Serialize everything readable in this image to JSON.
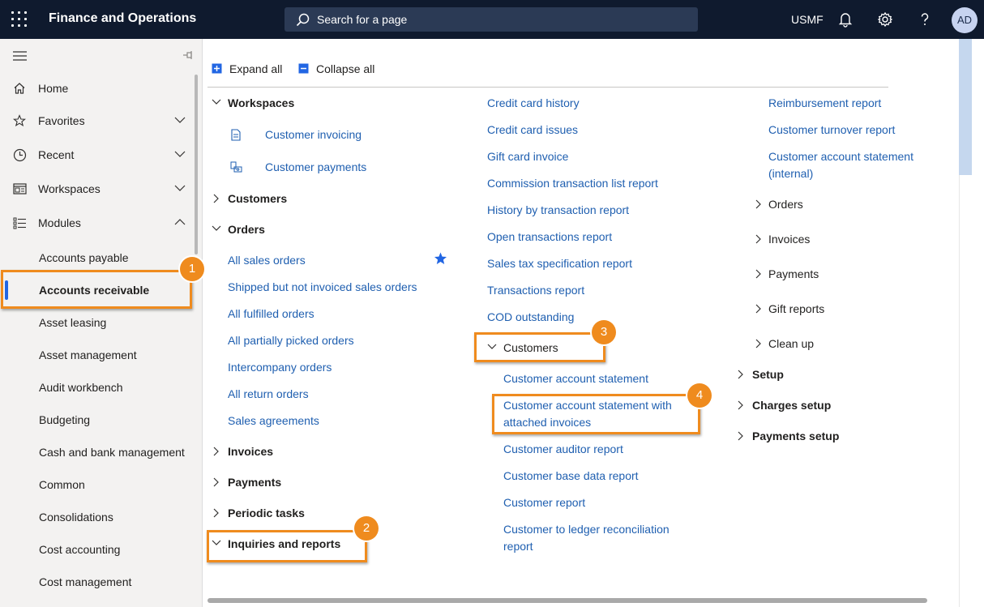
{
  "header": {
    "app_title": "Finance and Operations",
    "search_placeholder": "Search for a page",
    "company": "USMF",
    "avatar_initials": "AD"
  },
  "sidebar": {
    "nav": [
      {
        "label": "Home",
        "icon": "home-icon"
      },
      {
        "label": "Favorites",
        "icon": "star-icon"
      },
      {
        "label": "Recent",
        "icon": "clock-icon"
      },
      {
        "label": "Workspaces",
        "icon": "workspace-icon"
      },
      {
        "label": "Modules",
        "icon": "list-icon"
      }
    ],
    "modules": [
      "Accounts payable",
      "Accounts receivable",
      "Asset leasing",
      "Asset management",
      "Audit workbench",
      "Budgeting",
      "Cash and bank management",
      "Common",
      "Consolidations",
      "Cost accounting",
      "Cost management"
    ],
    "selected_module": "Accounts receivable"
  },
  "toolbar": {
    "expand_all": "Expand all",
    "collapse_all": "Collapse all"
  },
  "col1": {
    "workspaces": "Workspaces",
    "workspace_links": [
      "Customer invoicing",
      "Customer payments"
    ],
    "customers": "Customers",
    "orders": "Orders",
    "order_links": [
      "All sales orders",
      "Shipped but not invoiced sales orders",
      "All fulfilled orders",
      "All partially picked orders",
      "Intercompany orders",
      "All return orders",
      "Sales agreements"
    ],
    "invoices": "Invoices",
    "payments": "Payments",
    "periodic_tasks": "Periodic tasks",
    "inquiries_reports": "Inquiries and reports"
  },
  "col2": {
    "links": [
      "Credit card history",
      "Credit card issues",
      "Gift card invoice",
      "Commission transaction list report",
      "History by transaction report",
      "Open transactions report",
      "Sales tax specification report",
      "Transactions report",
      "COD outstanding"
    ],
    "customers_group": "Customers",
    "customer_links": [
      "Customer account statement",
      "Customer account statement with attached invoices",
      "Customer auditor report",
      "Customer base data report",
      "Customer report",
      "Customer to ledger reconciliation report"
    ]
  },
  "col3": {
    "links": [
      "Reimbursement report",
      "Customer turnover report",
      "Customer account statement (internal)"
    ],
    "groups": [
      "Orders",
      "Invoices",
      "Payments",
      "Gift reports",
      "Clean up"
    ],
    "sections": [
      "Setup",
      "Charges setup",
      "Payments setup"
    ]
  },
  "callouts": [
    "1",
    "2",
    "3",
    "4"
  ],
  "colors": {
    "topbar": "#0f1a2e",
    "link": "#1f5fb0",
    "callout": "#ef8b1e",
    "accent": "#2266e3"
  }
}
